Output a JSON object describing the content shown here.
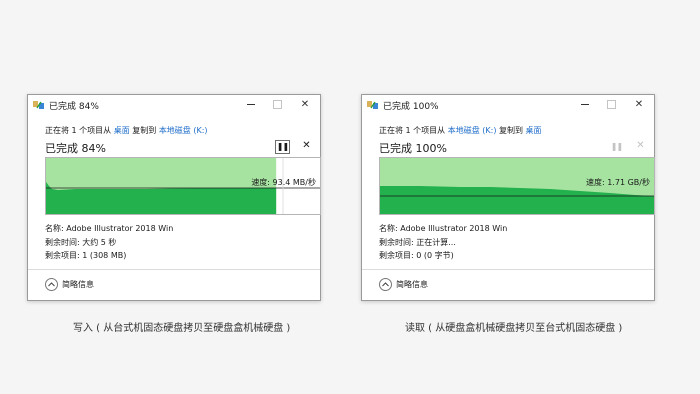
{
  "colors": {
    "graph_fill_light": "#a6e3a1",
    "graph_fill_dark": "#22b14c",
    "link_blue": "#1e6cc9",
    "window_border": "#9a9a9a"
  },
  "dialogs": [
    {
      "title": "已完成 84%",
      "copy_prefix": "正在将 1 个项目从 ",
      "source": "桌面",
      "copy_middle": " 复制到 ",
      "destination": "本地磁盘 (K:)",
      "progress_title": "已完成 84%",
      "progress_percent": 84,
      "speed": "速度: 93.4 MB/秒",
      "name_label": "名称: ",
      "name_value": "Adobe Illustrator 2018 Win",
      "time_label": "剩余时间: ",
      "time_value": "大约 5 秒",
      "items_label": "剩余项目: ",
      "items_value": "1 (308 MB)",
      "footer": "简略信息",
      "paused_enabled": true
    },
    {
      "title": "已完成 100%",
      "copy_prefix": "正在将 1 个项目从 ",
      "source": "本地磁盘 (K:)",
      "copy_middle": " 复制到 ",
      "destination": "桌面",
      "progress_title": "已完成 100%",
      "progress_percent": 100,
      "speed": "速度: 1.71 GB/秒",
      "name_label": "名称: ",
      "name_value": "Adobe Illustrator 2018 Win",
      "time_label": "剩余时间: ",
      "time_value": "正在计算...",
      "items_label": "剩余项目: ",
      "items_value": "0 (0 字节)",
      "footer": "简略信息",
      "paused_enabled": false
    }
  ],
  "captions": {
    "left": "写入 ( 从台式机固态硬盘拷贝至硬盘盒机械硬盘 )",
    "right": "读取 ( 从硬盘盒机械硬盘拷贝至台式机固态硬盘 )"
  }
}
